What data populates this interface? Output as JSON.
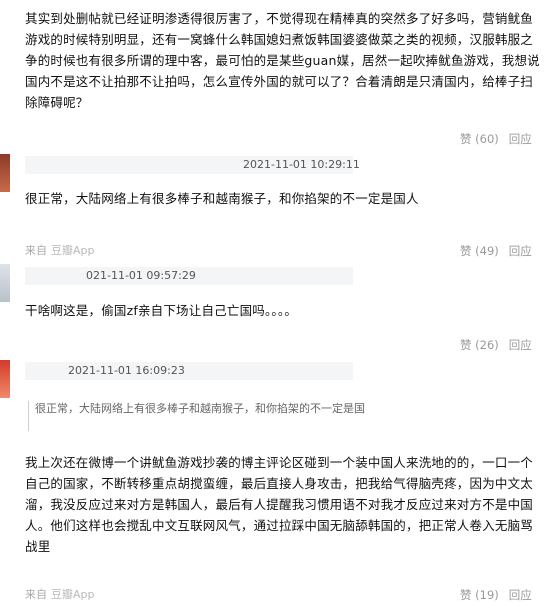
{
  "comments": [
    {
      "text": "其实到处删帖就已经证明渗透得很厉害了，不觉得现在精棒真的突然多了好多吗，营销鱿鱼游戏的时候特别明显，还有一窝蜂什么韩国媳妇煮饭韩国婆婆做菜之类的视频，汉服韩服之争的时候也有很多所谓的理中客，最可怕的是某些guan媒，居然一起吹捧鱿鱼游戏，我想说国内不是这不让拍那不让拍吗，怎么宣传外国的就可以了？合着清朗是只清国内，给棒子扫除障碍呢？",
      "like_label": "赞 (60)",
      "reply_label": "回应"
    },
    {
      "timestamp": "2021-11-01 10:29:11",
      "text": "很正常，大陆网络上有很多棒子和越南猴子，和你掐架的不一定是国人",
      "source_prefix": "来自",
      "source_app": "豆瓣App",
      "like_label": "赞 (49)",
      "reply_label": "回应"
    },
    {
      "timestamp": "021-11-01 09:57:29",
      "text": "干啥啊这是，偷国zf亲自下场让自己亡国吗。。。。",
      "like_label": "赞 (26)",
      "reply_label": "回应"
    },
    {
      "timestamp": "2021-11-01 16:09:23",
      "quote": "很正常，大陆网络上有很多棒子和越南猴子，和你掐架的不一定是国",
      "text": "我上次还在微博一个讲鱿鱼游戏抄袭的博主评论区碰到一个装中国人来洗地的的，一口一个自己的国家，不断转移重点胡搅蛮缠，最后直接人身攻击，把我给气得脑壳疼，因为中文太溜，我没反应过来对方是韩国人，最后有人提醒我习惯用语不对我才反应过来对方不是中国人。他们这样也会搅乱中文互联网风气，通过拉踩中国无脑舔韩国的，把正常人卷入无脑骂战里",
      "source_prefix": "来自",
      "source_app": "豆瓣App",
      "like_label": "赞 (19)",
      "reply_label": "回应"
    }
  ]
}
